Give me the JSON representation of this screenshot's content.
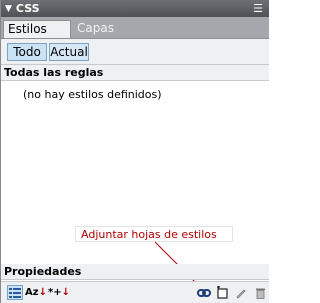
{
  "panel": {
    "title": "CSS",
    "collapse_glyph": "▼",
    "menu_icon": "panel-menu-icon",
    "menu_glyph": "☰"
  },
  "tabs": [
    {
      "label": "Estilos CSS",
      "active": true
    },
    {
      "label": "Capas",
      "active": false
    }
  ],
  "mode_toggle": [
    {
      "label": "Todo",
      "selected": true
    },
    {
      "label": "Actual",
      "selected": false
    }
  ],
  "rules_section": {
    "header": "Todas las reglas",
    "empty_message": "(no hay estilos definidos)"
  },
  "callout": {
    "text": "Adjuntar hojas de estilos",
    "color": "#b00000"
  },
  "properties_section": {
    "header": "Propiedades"
  },
  "toolbar": {
    "list_view_icon": "category-list-icon",
    "az_label": "Az",
    "az_arrow": "↓",
    "set_label": "*+",
    "set_arrow": "↓",
    "attach_icon": "attach-stylesheet-icon",
    "new_rule_icon": "new-css-rule-icon",
    "edit_icon": "edit-style-icon",
    "delete_icon": "delete-rule-icon"
  },
  "colors": {
    "titlebar": "#5e6165",
    "tabbar": "#a4a8ad",
    "panel_bg": "#eef0f2",
    "selected_toggle": "#c9e2f5"
  }
}
